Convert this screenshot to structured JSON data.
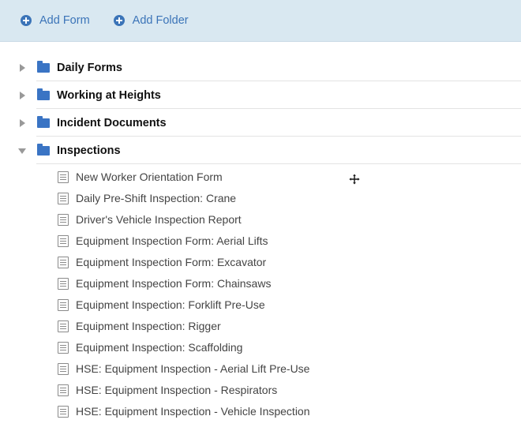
{
  "toolbar": {
    "add_form_label": "Add Form",
    "add_folder_label": "Add Folder",
    "accent_color": "#3b74b8",
    "icon": "plus-circle-icon"
  },
  "tree": {
    "folders": [
      {
        "label": "Daily Forms",
        "state": "collapsed"
      },
      {
        "label": "Working at Heights",
        "state": "collapsed"
      },
      {
        "label": "Incident Documents",
        "state": "collapsed"
      },
      {
        "label": "Inspections",
        "state": "expanded"
      }
    ],
    "inspections_forms": [
      "New Worker Orientation Form",
      "Daily Pre-Shift Inspection: Crane",
      "Driver's Vehicle Inspection Report",
      "Equipment Inspection Form: Aerial Lifts",
      "Equipment Inspection Form: Excavator",
      "Equipment Inspection Form: Chainsaws",
      "Equipment Inspection: Forklift Pre-Use",
      "Equipment Inspection: Rigger",
      "Equipment Inspection: Scaffolding",
      "HSE: Equipment Inspection - Aerial Lift Pre-Use",
      "HSE: Equipment Inspection - Respirators",
      "HSE: Equipment Inspection - Vehicle Inspection"
    ],
    "folder_color": "#3a74c4",
    "folder_icon": "folder-icon",
    "form_icon": "document-icon"
  }
}
